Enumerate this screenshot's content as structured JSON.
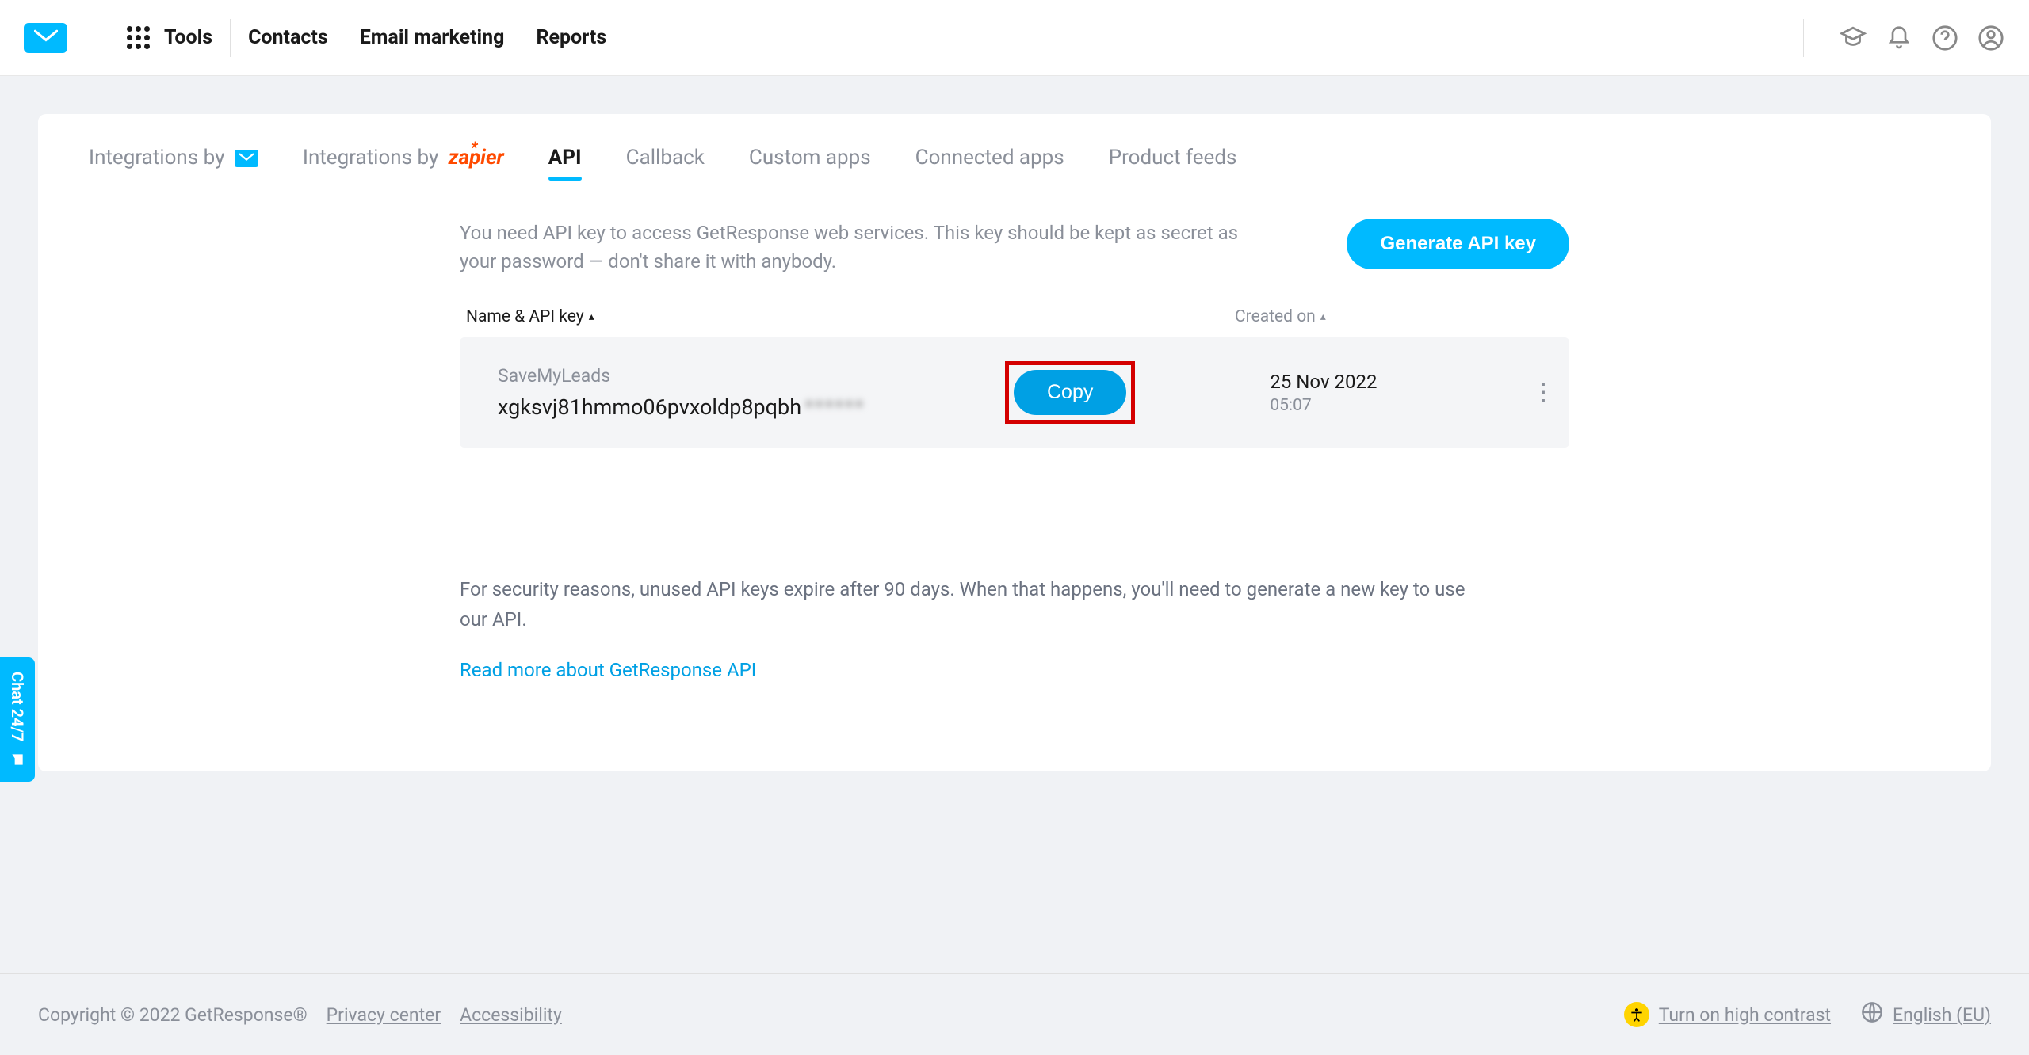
{
  "nav": {
    "tools": "Tools",
    "contacts": "Contacts",
    "email_marketing": "Email marketing",
    "reports": "Reports"
  },
  "tabs": {
    "integrations_by_gr": "Integrations by",
    "integrations_by_zap": "Integrations by",
    "zap_brand": "zapier",
    "api": "API",
    "callback": "Callback",
    "custom_apps": "Custom apps",
    "connected_apps": "Connected apps",
    "product_feeds": "Product feeds"
  },
  "intro": {
    "text": "You need API key to access GetResponse web services. This key should be kept as secret as your password — don't share it with anybody.",
    "generate_btn": "Generate API key"
  },
  "table": {
    "header_name": "Name & API key",
    "header_created": "Created on",
    "row": {
      "name": "SaveMyLeads",
      "key_visible": "xgksvj81hmmo06pvxoldp8pqbh",
      "key_hidden": "******",
      "copy_btn": "Copy",
      "created_date": "25 Nov 2022",
      "created_time": "05:07"
    }
  },
  "info": {
    "text": "For security reasons, unused API keys expire after 90 days. When that happens, you'll need to generate a new key to use our API.",
    "link": "Read more about GetResponse API"
  },
  "footer": {
    "copyright": "Copyright © 2022 GetResponse®",
    "privacy": "Privacy center",
    "accessibility": "Accessibility",
    "contrast": "Turn on high contrast",
    "language": "English (EU)"
  },
  "chat": {
    "label": "Chat 24/7"
  }
}
